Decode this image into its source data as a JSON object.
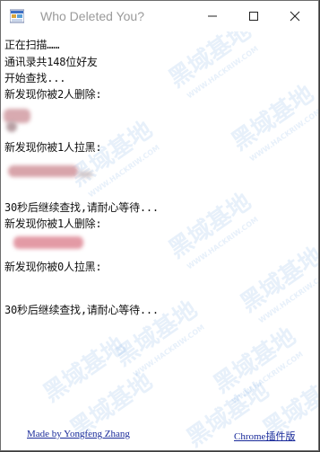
{
  "window": {
    "title": "Who Deleted You?",
    "controls": {
      "minimize": "—",
      "maximize": "☐",
      "close": "✕"
    }
  },
  "log_lines": [
    "正在扫描……",
    "通讯录共148位好友",
    "开始查找...",
    "新发现你被2人删除:",
    "新发现你被1人拉黑:",
    "30秒后继续查找,请耐心等待...",
    "新发现你被1人删除:",
    "新发现你被0人拉黑:",
    "30秒后继续查找,请耐心等待..."
  ],
  "footer": {
    "left_link": "Made by Yongfeng Zhang",
    "right_link": "Chrome插件版"
  },
  "watermark": {
    "big": "黑域基地",
    "small": "WWW.HACKRIW.COM"
  },
  "colors": {
    "redacted": "#e8a0a8",
    "redacted_gray": "#c9a9ad",
    "link": "#1a2b9a"
  }
}
